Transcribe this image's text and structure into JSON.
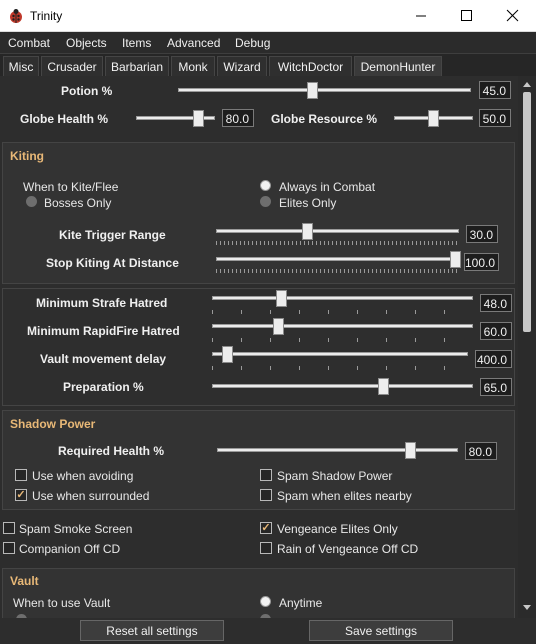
{
  "window": {
    "title": "Trinity",
    "app_icon": "ladybug-icon"
  },
  "menu": [
    "Combat",
    "Objects",
    "Items",
    "Advanced",
    "Debug"
  ],
  "tabs": [
    "Misc",
    "Crusader",
    "Barbarian",
    "Monk",
    "Wizard",
    "WitchDoctor",
    "DemonHunter"
  ],
  "top_sliders": {
    "potion": {
      "label": "Potion %",
      "value": "45.0"
    },
    "globe_health": {
      "label": "Globe Health %",
      "value": "80.0"
    },
    "globe_resource": {
      "label": "Globe Resource %",
      "value": "50.0"
    }
  },
  "kiting": {
    "title": "Kiting",
    "when_label": "When to Kite/Flee",
    "options": [
      "Bosses Only",
      "Always in Combat",
      "Elites Only"
    ],
    "selected": "Always in Combat",
    "trigger": {
      "label": "Kite Trigger Range",
      "value": "30.0"
    },
    "stop": {
      "label": "Stop Kiting At Distance",
      "value": "100.0"
    }
  },
  "strafe": {
    "min_strafe": {
      "label": "Minimum Strafe Hatred",
      "value": "48.0"
    },
    "min_rapidfire": {
      "label": "Minimum RapidFire Hatred",
      "value": "60.0"
    },
    "vault_delay": {
      "label": "Vault movement delay",
      "value": "400.0"
    },
    "preparation": {
      "label": "Preparation %",
      "value": "65.0"
    }
  },
  "shadow": {
    "title": "Shadow Power",
    "required": {
      "label": "Required Health %",
      "value": "80.0"
    },
    "checks": [
      {
        "label": "Use when avoiding",
        "checked": false
      },
      {
        "label": "Spam Shadow Power",
        "checked": false
      },
      {
        "label": "Use when surrounded",
        "checked": true
      },
      {
        "label": "Spam when elites nearby",
        "checked": false
      }
    ]
  },
  "misc_checks": [
    {
      "label": "Spam Smoke Screen",
      "checked": false
    },
    {
      "label": "Vengeance Elites Only",
      "checked": true
    },
    {
      "label": "Companion Off CD",
      "checked": false
    },
    {
      "label": "Rain of Vengeance Off CD",
      "checked": false
    }
  ],
  "vault": {
    "title": "Vault",
    "when_label": "When to use Vault",
    "options": [
      "Anytime"
    ],
    "selected": "Anytime"
  },
  "buttons": {
    "reset": "Reset all settings",
    "save": "Save settings"
  },
  "colors": {
    "accent": "#e8b877",
    "panel": "#2d2d2d",
    "titlebar": "#ffffff"
  }
}
